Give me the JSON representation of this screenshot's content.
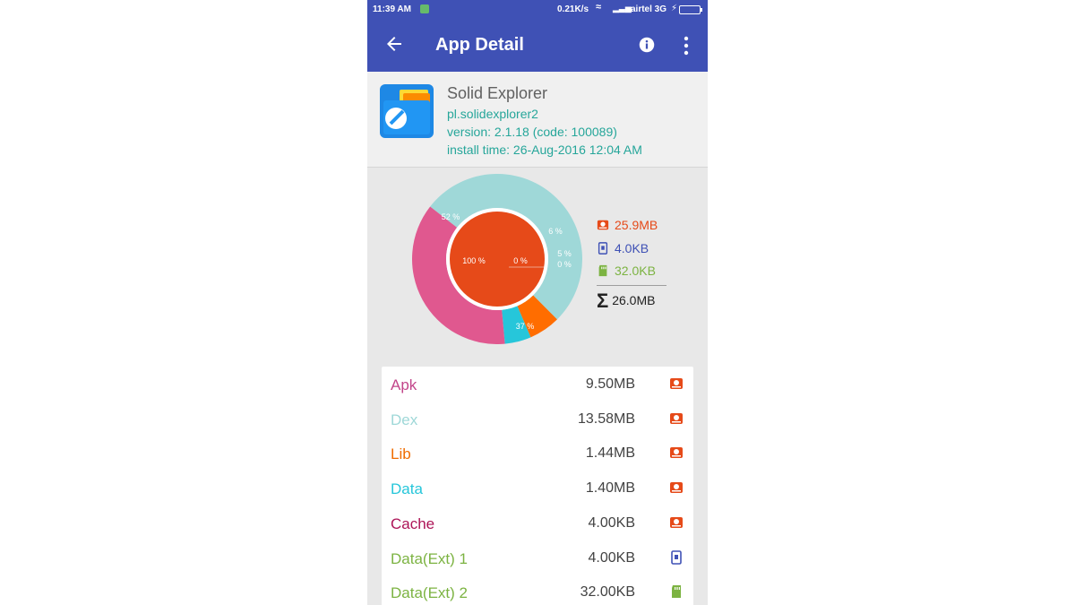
{
  "status_bar": {
    "time": "11:39 AM",
    "speed": "0.21K/s",
    "carrier": "airtel 3G",
    "icons": [
      "notification-icon",
      "wifi-icon",
      "signal-icon",
      "charging-icon",
      "battery-icon"
    ]
  },
  "app_bar": {
    "title": "App Detail",
    "color": "#3f51b5",
    "icons": [
      "back-arrow-icon",
      "info-icon",
      "more-vert-icon"
    ]
  },
  "app_info": {
    "name": "Solid Explorer",
    "package": "pl.solidexplorer2",
    "version": "version: 2.1.18 (code: 100089)",
    "install_time": "install time: 26-Aug-2016 12:04 AM",
    "accent_color": "#26a69a"
  },
  "chart": {
    "inner_label_left": "100 %",
    "inner_label_right": "0 %",
    "outer_labels": {
      "dex": "52 %",
      "lib": "6 %",
      "data": "5 %",
      "cache": "0 %",
      "apk": "37 %"
    }
  },
  "chart_data": {
    "type": "pie",
    "inner_ring": {
      "labels": [
        "100 %",
        "0 %"
      ],
      "values": [
        100,
        0
      ],
      "colors": [
        "#e64a19",
        "#e64a19"
      ]
    },
    "outer_ring": {
      "categories": [
        "Dex",
        "Lib",
        "Data",
        "Cache",
        "Apk"
      ],
      "values": [
        52,
        6,
        5,
        0,
        37
      ],
      "labels": [
        "52 %",
        "6 %",
        "5 %",
        "0 %",
        "37 %"
      ],
      "colors": [
        "#9fd8d8",
        "#ff6d00",
        "#26c6da",
        "#c2185b",
        "#e0588f"
      ]
    }
  },
  "legend": {
    "internal": "25.9MB",
    "external": "4.0KB",
    "sd_card": "32.0KB",
    "total": "26.0MB",
    "colors": {
      "internal": "#e64a19",
      "external": "#3f51b5",
      "sd_card": "#7cb342",
      "total": "#212121"
    }
  },
  "rows": [
    {
      "label": "Apk",
      "value": "9.50MB",
      "color": "#c2458a",
      "storage_icon": "internal-storage-icon"
    },
    {
      "label": "Dex",
      "value": "13.58MB",
      "color": "#9fd8d8",
      "storage_icon": "internal-storage-icon"
    },
    {
      "label": "Lib",
      "value": "1.44MB",
      "color": "#ef6c00",
      "storage_icon": "internal-storage-icon"
    },
    {
      "label": "Data",
      "value": "1.40MB",
      "color": "#26c6da",
      "storage_icon": "internal-storage-icon"
    },
    {
      "label": "Cache",
      "value": "4.00KB",
      "color": "#ad1457",
      "storage_icon": "internal-storage-icon"
    },
    {
      "label": "Data(Ext) 1",
      "value": "4.00KB",
      "color": "#7cb342",
      "storage_icon": "phone-storage-icon"
    },
    {
      "label": "Data(Ext) 2",
      "value": "32.00KB",
      "color": "#7cb342",
      "storage_icon": "sd-card-icon"
    }
  ]
}
